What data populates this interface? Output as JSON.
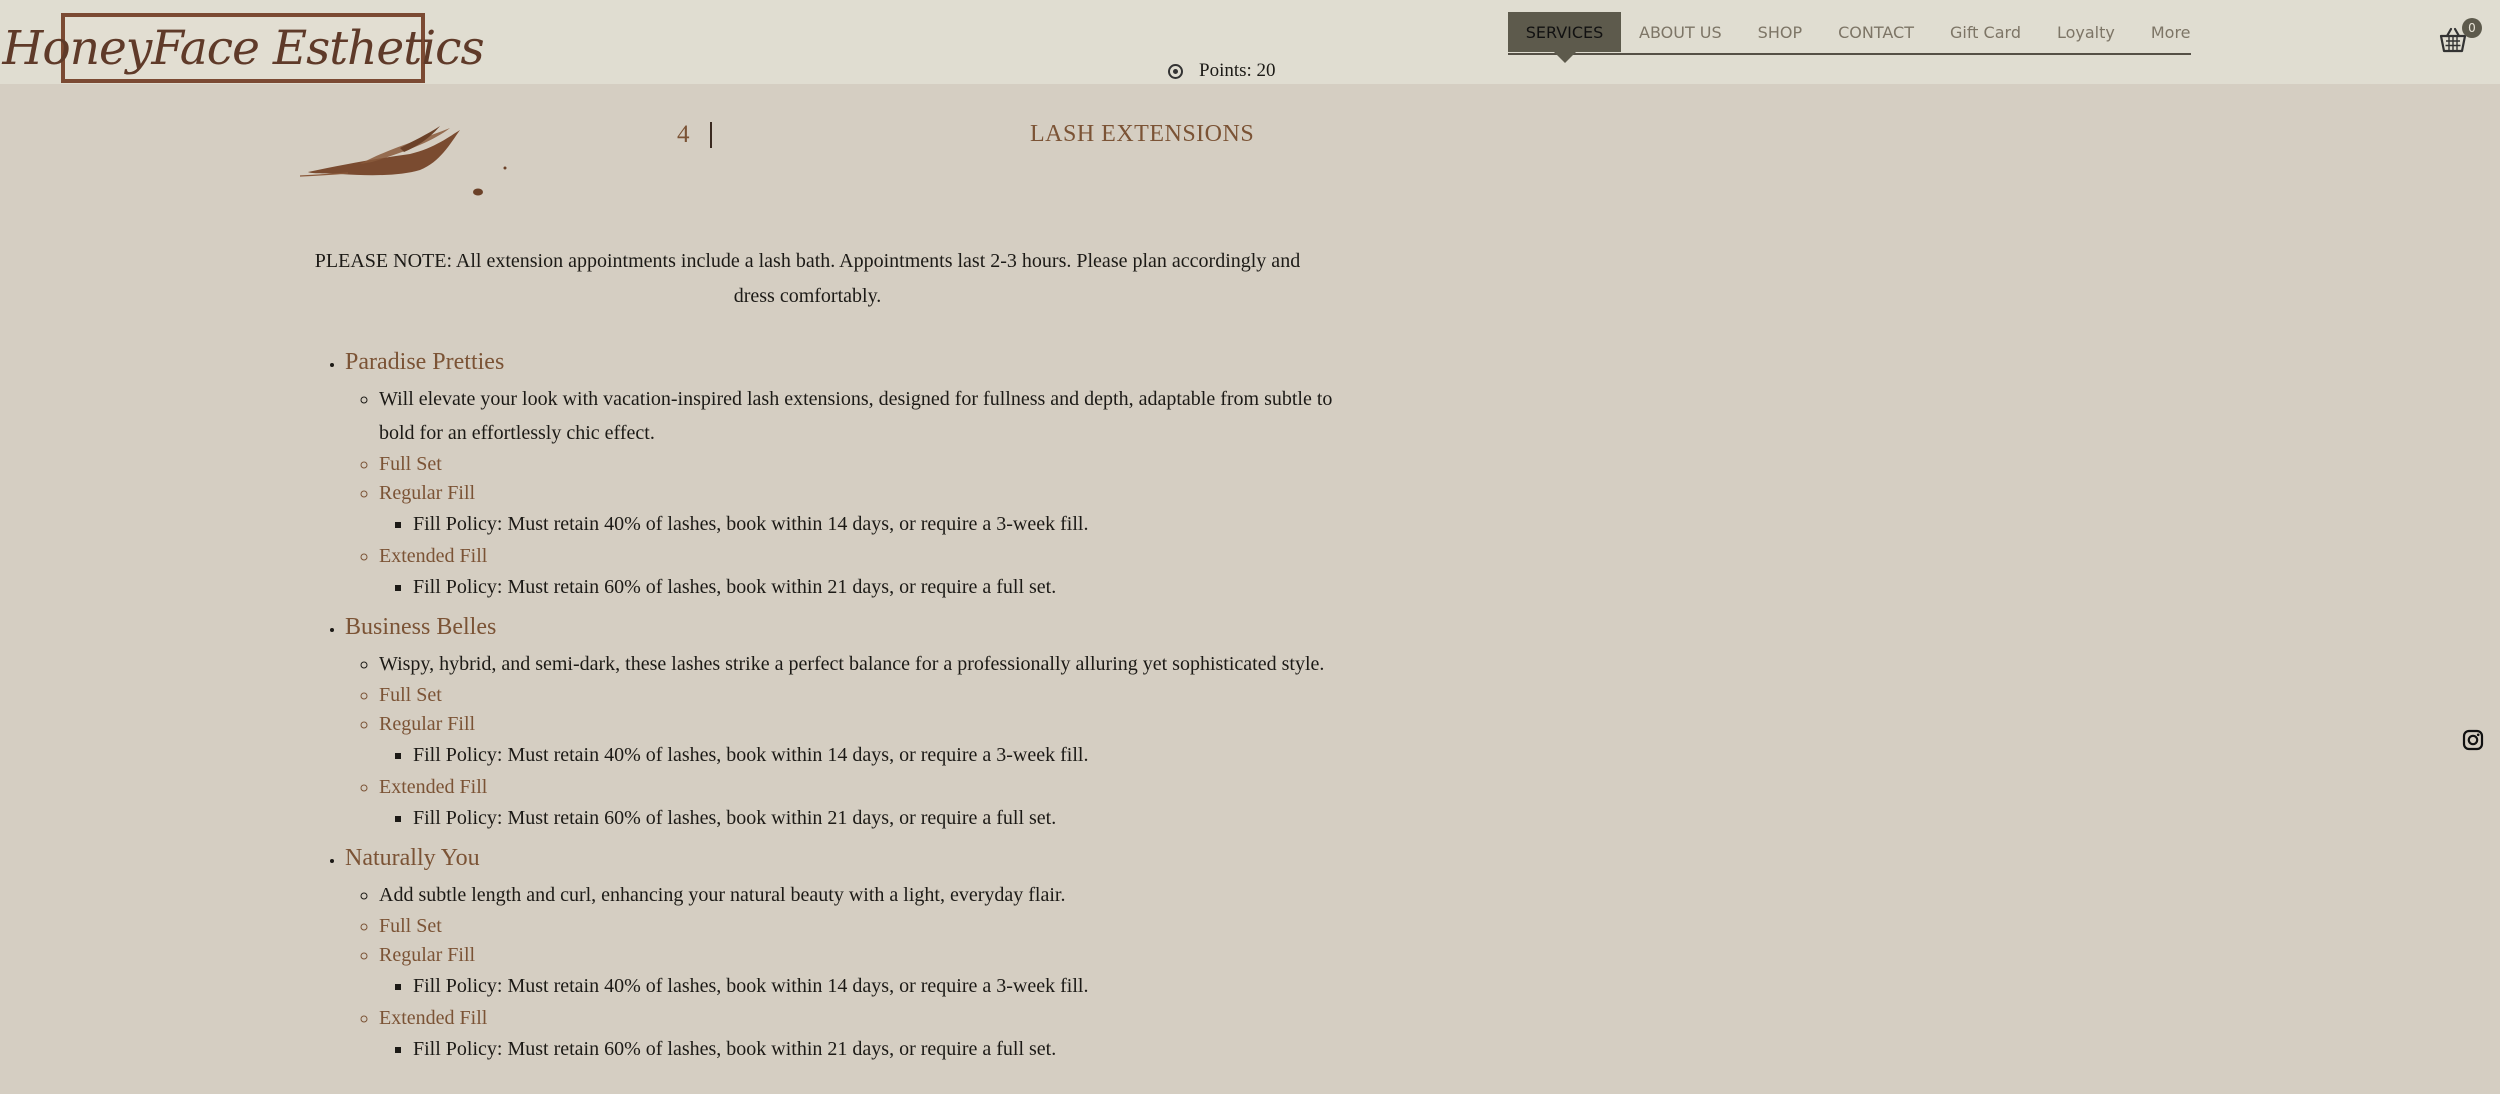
{
  "brand": {
    "logo_text": "HoneyFace Esthetics"
  },
  "header": {
    "points_label": "Points: 20"
  },
  "nav": {
    "items": [
      {
        "label": "SERVICES",
        "active": true
      },
      {
        "label": "ABOUT US"
      },
      {
        "label": "SHOP"
      },
      {
        "label": "CONTACT"
      },
      {
        "label": "Gift Card"
      },
      {
        "label": "Loyalty"
      },
      {
        "label": "More"
      }
    ]
  },
  "cart": {
    "count": "0"
  },
  "page": {
    "number": "4",
    "title": "LASH EXTENSIONS",
    "note": "PLEASE NOTE: All extension appointments include a lash bath. Appointments last 2-3 hours. Please plan accordingly and dress comfortably."
  },
  "services": [
    {
      "name": "Paradise Pretties",
      "description": "Will elevate your look with vacation-inspired lash extensions, designed for fullness and depth, adaptable from subtle to bold for an effortlessly chic effect.",
      "full_set": "Full Set",
      "regular_fill": "Regular Fill",
      "regular_policy": "Fill Policy: Must retain 40% of lashes, book within 14 days, or require a 3-week fill.",
      "extended_fill": "Extended Fill",
      "extended_policy": "Fill Policy: Must retain 60% of lashes, book within 21 days, or require a full set."
    },
    {
      "name": "Business Belles",
      "description": "Wispy, hybrid, and semi-dark, these lashes strike a perfect balance for a professionally alluring yet sophisticated style.",
      "full_set": "Full Set",
      "regular_fill": "Regular Fill",
      "regular_policy": "Fill Policy: Must retain 40% of lashes, book within 14 days, or require a 3-week fill.",
      "extended_fill": "Extended Fill",
      "extended_policy": "Fill Policy: Must retain 60% of lashes, book within 21 days, or require a full set."
    },
    {
      "name": "Naturally You",
      "description": "Add subtle length and curl, enhancing your natural beauty with a light, everyday flair.",
      "full_set": "Full Set",
      "regular_fill": "Regular Fill",
      "regular_policy": "Fill Policy: Must retain 40% of lashes, book within 14 days, or require a 3-week fill.",
      "extended_fill": "Extended Fill",
      "extended_policy": "Fill Policy: Must retain 60% of lashes, book within 21 days, or require a full set."
    }
  ],
  "icons": {
    "points": "points-circle-icon",
    "cart": "shopping-basket-icon",
    "social": "instagram-icon",
    "decoration": "brush-stroke-icon"
  },
  "colors": {
    "header_bg": "#e0ddd1",
    "page_bg": "#d5cec2",
    "accent_brown": "#7b5335",
    "nav_active": "#5d5a4c"
  }
}
